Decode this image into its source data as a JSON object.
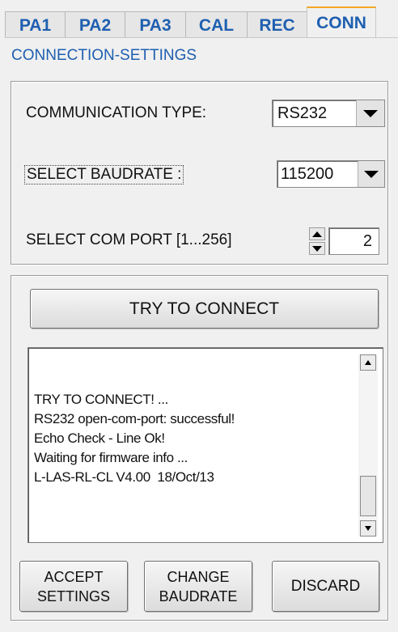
{
  "tabs": [
    {
      "label": "PA1"
    },
    {
      "label": "PA2"
    },
    {
      "label": "PA3"
    },
    {
      "label": "CAL"
    },
    {
      "label": "REC"
    },
    {
      "label": "CONN"
    }
  ],
  "section_title": "CONNECTION-SETTINGS",
  "settings": {
    "communication_type_label": "COMMUNICATION TYPE:",
    "communication_type_value": "RS232",
    "baudrate_label": "SELECT BAUDRATE :",
    "baudrate_value": "115200",
    "com_port_label": "SELECT COM PORT [1...256]",
    "com_port_value": "2"
  },
  "connect": {
    "try_button": "TRY TO CONNECT",
    "log_lines": [
      "TRY TO CONNECT! ...",
      "RS232 open-com-port: successful!",
      "Echo Check - Line Ok!",
      "Waiting for firmware info ...",
      "L-LAS-RL-CL V4.00  18/Oct/13"
    ],
    "accept_button": [
      "ACCEPT",
      "SETTINGS"
    ],
    "change_button": [
      "CHANGE",
      "BAUDRATE"
    ],
    "discard_button": "DISCARD"
  },
  "colors": {
    "accent_text": "#1e5fb0",
    "active_tab_border": "#f5a623"
  }
}
